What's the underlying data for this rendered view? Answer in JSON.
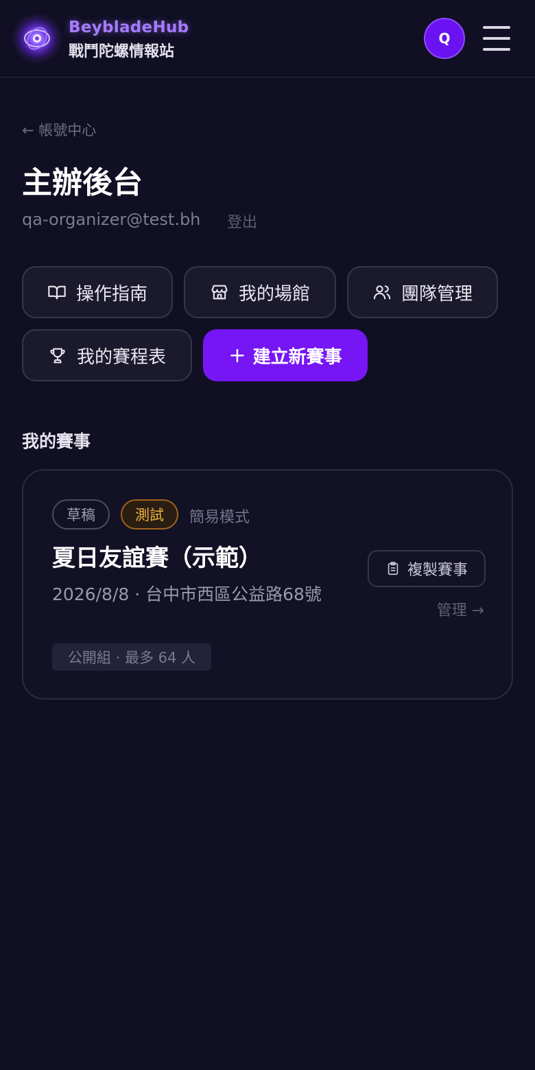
{
  "header": {
    "brand_name": "BeybladeHub",
    "brand_subtitle": "戰鬥陀螺情報站",
    "avatar_initial": "Q",
    "logo_icon": "beyblade-logo-icon",
    "menu_icon": "hamburger-menu-icon"
  },
  "nav": {
    "back_label": "← 帳號中心"
  },
  "page": {
    "title": "主辦後台",
    "email": "qa-organizer@test.bh",
    "logout_label": "登出"
  },
  "actions": [
    {
      "label": "操作指南",
      "icon": "book-icon"
    },
    {
      "label": "我的場館",
      "icon": "store-icon"
    },
    {
      "label": "團隊管理",
      "icon": "users-icon"
    },
    {
      "label": "我的賽程表",
      "icon": "trophy-icon"
    }
  ],
  "primary_action": {
    "plus": "+",
    "label": "建立新賽事"
  },
  "events_section": {
    "title": "我的賽事",
    "events": [
      {
        "badges": [
          "草稿",
          "測試"
        ],
        "mode": "簡易模式",
        "title": "夏日友誼賽（示範）",
        "meta": "2026/8/8 · 台中市西區公益路68號",
        "tag": "公開組 · 最多 64 人",
        "copy_label": "複製賽事",
        "manage_label": "管理 →"
      }
    ]
  },
  "colors": {
    "background": "#100f23",
    "accent": "#7616f5",
    "brand": "#a57bff",
    "test_badge": "#f0b540"
  }
}
